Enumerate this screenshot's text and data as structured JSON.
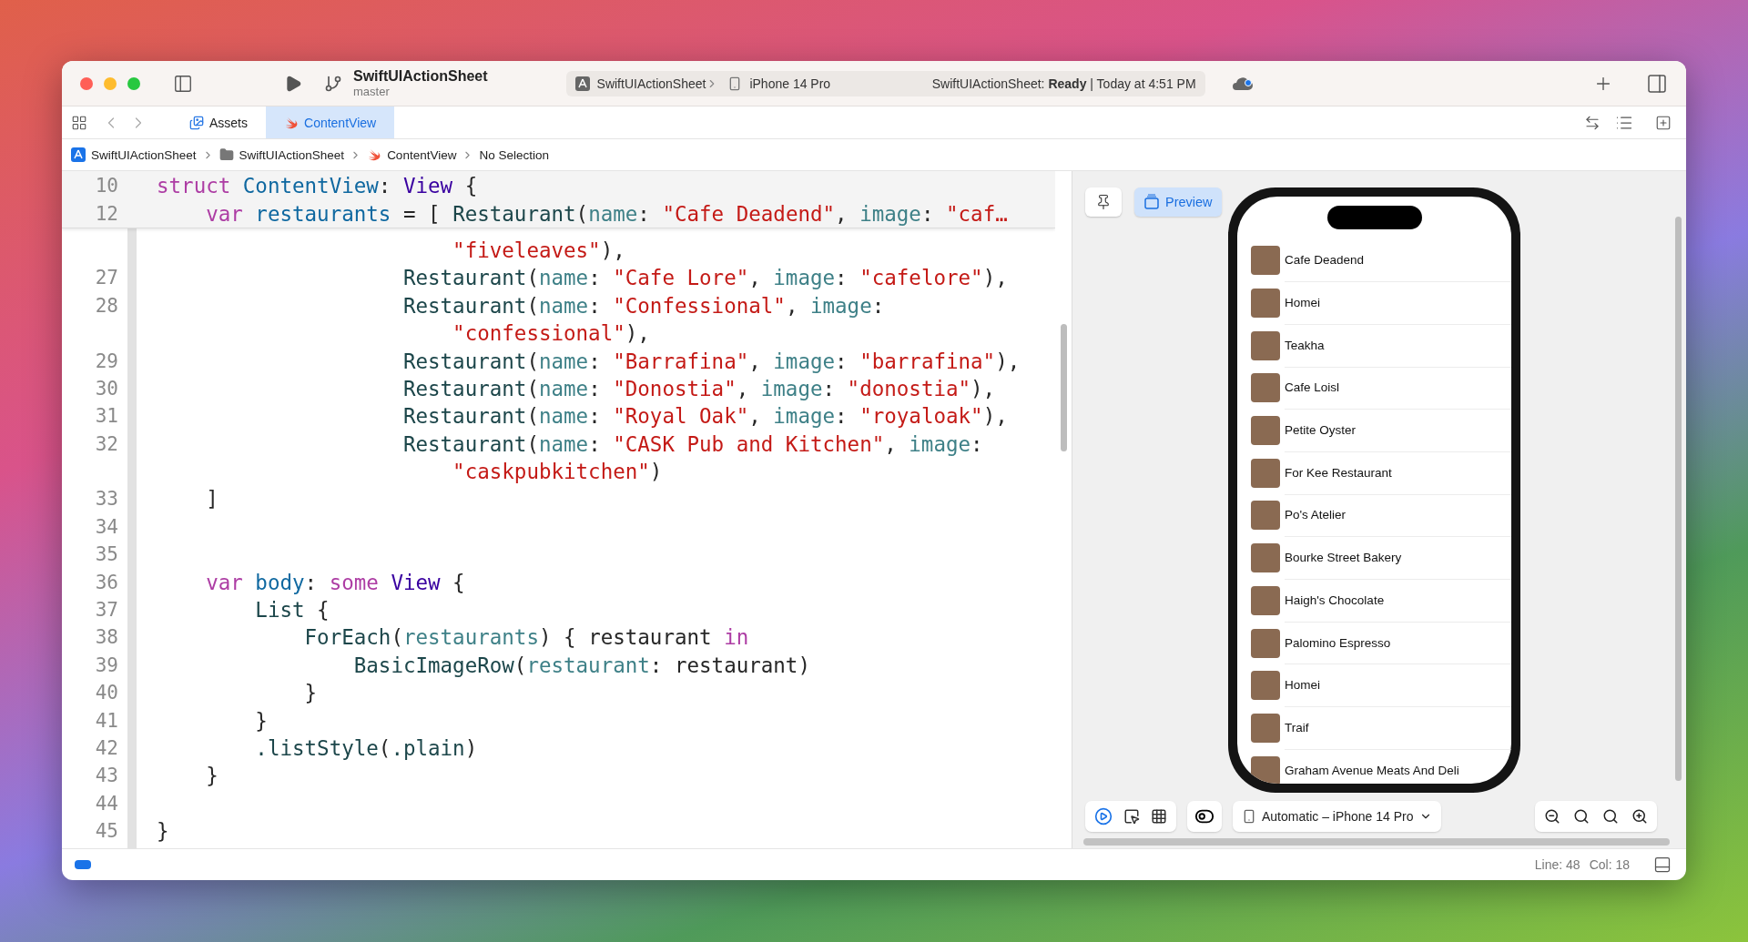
{
  "toolbar": {
    "scheme_title": "SwiftUIActionSheet",
    "branch": "master",
    "activity": {
      "scheme": "SwiftUIActionSheet",
      "device": "iPhone 14 Pro",
      "status": "SwiftUIActionSheet: **Ready** | Today at 4:51 PM"
    }
  },
  "tabs": [
    {
      "label": "Assets",
      "kind": "assets",
      "selected": false
    },
    {
      "label": "ContentView",
      "kind": "swift",
      "selected": true
    }
  ],
  "breadcrumb": [
    {
      "label": "SwiftUIActionSheet",
      "kind": "app"
    },
    {
      "label": "SwiftUIActionSheet",
      "kind": "folder"
    },
    {
      "label": "ContentView",
      "kind": "swift"
    },
    {
      "label": "No Selection",
      "kind": "plain"
    }
  ],
  "editor": {
    "sticky_lines": [
      {
        "number": "10",
        "segments": [
          {
            "kind": "kw",
            "text": "struct"
          },
          {
            "kind": "decl",
            "text": " ContentView"
          },
          {
            "kind": "plain",
            "text": ": "
          },
          {
            "kind": "type",
            "text": "View"
          },
          {
            "kind": "plain",
            "text": " {"
          }
        ]
      },
      {
        "number": "12",
        "segments": [
          {
            "kind": "kw",
            "text": "    var"
          },
          {
            "kind": "decl",
            "text": " restaurants"
          },
          {
            "kind": "plain",
            "text": " = [ "
          },
          {
            "kind": "call",
            "text": "Restaurant"
          },
          {
            "kind": "plain",
            "text": "("
          },
          {
            "kind": "param",
            "text": "name"
          },
          {
            "kind": "plain",
            "text": ": "
          },
          {
            "kind": "str",
            "text": "\"Cafe Deadend\""
          },
          {
            "kind": "plain",
            "text": ", "
          },
          {
            "kind": "param",
            "text": "image"
          },
          {
            "kind": "plain",
            "text": ": "
          },
          {
            "kind": "str",
            "text": "\"caf…"
          }
        ]
      }
    ],
    "lines": [
      {
        "segments": [
          {
            "kind": "str",
            "text": "                        \"fiveleaves\""
          },
          {
            "kind": "plain",
            "text": "),"
          }
        ]
      },
      {
        "number": "27",
        "segments": [
          {
            "kind": "call",
            "text": "                    Restaurant"
          },
          {
            "kind": "plain",
            "text": "("
          },
          {
            "kind": "param",
            "text": "name"
          },
          {
            "kind": "plain",
            "text": ": "
          },
          {
            "kind": "str",
            "text": "\"Cafe Lore\""
          },
          {
            "kind": "plain",
            "text": ", "
          },
          {
            "kind": "param",
            "text": "image"
          },
          {
            "kind": "plain",
            "text": ": "
          },
          {
            "kind": "str",
            "text": "\"cafelore\""
          },
          {
            "kind": "plain",
            "text": "),"
          }
        ]
      },
      {
        "number": "28",
        "segments": [
          {
            "kind": "call",
            "text": "                    Restaurant"
          },
          {
            "kind": "plain",
            "text": "("
          },
          {
            "kind": "param",
            "text": "name"
          },
          {
            "kind": "plain",
            "text": ": "
          },
          {
            "kind": "str",
            "text": "\"Confessional\""
          },
          {
            "kind": "plain",
            "text": ", "
          },
          {
            "kind": "param",
            "text": "image"
          },
          {
            "kind": "plain",
            "text": ":"
          }
        ]
      },
      {
        "segments": [
          {
            "kind": "str",
            "text": "                        \"confessional\""
          },
          {
            "kind": "plain",
            "text": "),"
          }
        ]
      },
      {
        "number": "29",
        "segments": [
          {
            "kind": "call",
            "text": "                    Restaurant"
          },
          {
            "kind": "plain",
            "text": "("
          },
          {
            "kind": "param",
            "text": "name"
          },
          {
            "kind": "plain",
            "text": ": "
          },
          {
            "kind": "str",
            "text": "\"Barrafina\""
          },
          {
            "kind": "plain",
            "text": ", "
          },
          {
            "kind": "param",
            "text": "image"
          },
          {
            "kind": "plain",
            "text": ": "
          },
          {
            "kind": "str",
            "text": "\"barrafina\""
          },
          {
            "kind": "plain",
            "text": "),"
          }
        ]
      },
      {
        "number": "30",
        "segments": [
          {
            "kind": "call",
            "text": "                    Restaurant"
          },
          {
            "kind": "plain",
            "text": "("
          },
          {
            "kind": "param",
            "text": "name"
          },
          {
            "kind": "plain",
            "text": ": "
          },
          {
            "kind": "str",
            "text": "\"Donostia\""
          },
          {
            "kind": "plain",
            "text": ", "
          },
          {
            "kind": "param",
            "text": "image"
          },
          {
            "kind": "plain",
            "text": ": "
          },
          {
            "kind": "str",
            "text": "\"donostia\""
          },
          {
            "kind": "plain",
            "text": "),"
          }
        ]
      },
      {
        "number": "31",
        "segments": [
          {
            "kind": "call",
            "text": "                    Restaurant"
          },
          {
            "kind": "plain",
            "text": "("
          },
          {
            "kind": "param",
            "text": "name"
          },
          {
            "kind": "plain",
            "text": ": "
          },
          {
            "kind": "str",
            "text": "\"Royal Oak\""
          },
          {
            "kind": "plain",
            "text": ", "
          },
          {
            "kind": "param",
            "text": "image"
          },
          {
            "kind": "plain",
            "text": ": "
          },
          {
            "kind": "str",
            "text": "\"royaloak\""
          },
          {
            "kind": "plain",
            "text": "),"
          }
        ]
      },
      {
        "number": "32",
        "segments": [
          {
            "kind": "call",
            "text": "                    Restaurant"
          },
          {
            "kind": "plain",
            "text": "("
          },
          {
            "kind": "param",
            "text": "name"
          },
          {
            "kind": "plain",
            "text": ": "
          },
          {
            "kind": "str",
            "text": "\"CASK Pub and Kitchen\""
          },
          {
            "kind": "plain",
            "text": ", "
          },
          {
            "kind": "param",
            "text": "image"
          },
          {
            "kind": "plain",
            "text": ":"
          }
        ]
      },
      {
        "segments": [
          {
            "kind": "str",
            "text": "                        \"caskpubkitchen\""
          },
          {
            "kind": "plain",
            "text": ")"
          }
        ]
      },
      {
        "number": "33",
        "segments": [
          {
            "kind": "plain",
            "text": "    ]"
          }
        ]
      },
      {
        "number": "34"
      },
      {
        "number": "35"
      },
      {
        "number": "36",
        "segments": [
          {
            "kind": "kw",
            "text": "    var"
          },
          {
            "kind": "decl",
            "text": " body"
          },
          {
            "kind": "plain",
            "text": ": "
          },
          {
            "kind": "kw",
            "text": "some"
          },
          {
            "kind": "type",
            "text": " View"
          },
          {
            "kind": "plain",
            "text": " {"
          }
        ]
      },
      {
        "number": "37",
        "segments": [
          {
            "kind": "call",
            "text": "        List"
          },
          {
            "kind": "plain",
            "text": " {"
          }
        ]
      },
      {
        "number": "38",
        "segments": [
          {
            "kind": "call",
            "text": "            ForEach"
          },
          {
            "kind": "plain",
            "text": "("
          },
          {
            "kind": "ref",
            "text": "restaurants"
          },
          {
            "kind": "plain",
            "text": ") { restaurant "
          },
          {
            "kind": "kw",
            "text": "in"
          }
        ]
      },
      {
        "number": "39",
        "segments": [
          {
            "kind": "call",
            "text": "                BasicImageRow"
          },
          {
            "kind": "plain",
            "text": "("
          },
          {
            "kind": "param",
            "text": "restaurant"
          },
          {
            "kind": "plain",
            "text": ": restaurant)"
          }
        ]
      },
      {
        "number": "40",
        "segments": [
          {
            "kind": "plain",
            "text": "            }"
          }
        ]
      },
      {
        "number": "41",
        "segments": [
          {
            "kind": "plain",
            "text": "        }"
          }
        ]
      },
      {
        "number": "42",
        "segments": [
          {
            "kind": "call",
            "text": "        .listStyle"
          },
          {
            "kind": "plain",
            "text": "("
          },
          {
            "kind": "call",
            "text": ".plain"
          },
          {
            "kind": "plain",
            "text": ")"
          }
        ]
      },
      {
        "number": "43",
        "segments": [
          {
            "kind": "plain",
            "text": "    }"
          }
        ]
      },
      {
        "number": "44"
      },
      {
        "number": "45",
        "segments": [
          {
            "kind": "plain",
            "text": "}"
          }
        ]
      }
    ]
  },
  "preview": {
    "preview_button": {
      "label": "Preview",
      "selected": true
    },
    "rows": [
      "Cafe Deadend",
      "Homei",
      "Teakha",
      "Cafe Loisl",
      "Petite Oyster",
      "For Kee Restaurant",
      "Po's Atelier",
      "Bourke Street Bakery",
      "Haigh's Chocolate",
      "Palomino Espresso",
      "Homei",
      "Traif",
      "Graham Avenue Meats And Deli"
    ],
    "modes": [
      {
        "kind": "live",
        "selected": true
      },
      {
        "kind": "select",
        "selected": false
      },
      {
        "kind": "variants",
        "selected": false
      }
    ],
    "device_menu": "Automatic – iPhone 14 Pro"
  },
  "status_bar": {
    "line": "Line: 48",
    "col": "Col: 18"
  }
}
